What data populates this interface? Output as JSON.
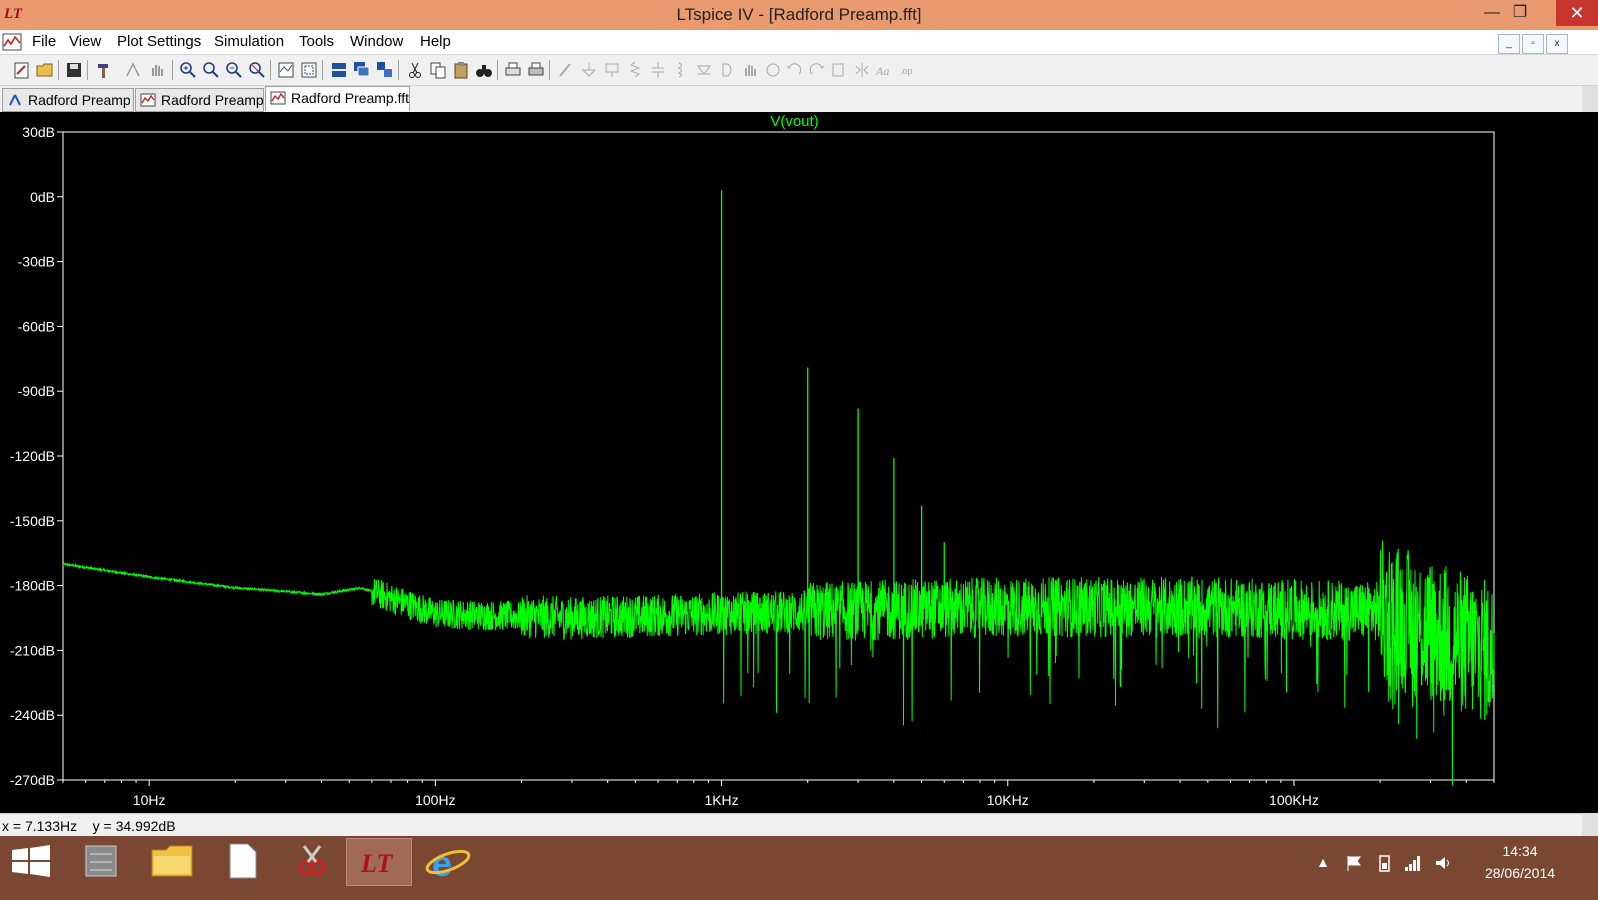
{
  "window": {
    "title": "LTspice IV - [Radford Preamp.fft]",
    "logo_text": "LT",
    "minimize": "—",
    "maximize": "❐",
    "close": "✕"
  },
  "menu": {
    "items": [
      "File",
      "View",
      "Plot Settings",
      "Simulation",
      "Tools",
      "Window",
      "Help"
    ],
    "mdi_buttons": [
      "_",
      "▫",
      "x"
    ]
  },
  "tabs": [
    {
      "label": "Radford Preamp",
      "icon": "schematic-icon"
    },
    {
      "label": "Radford Preamp",
      "icon": "waveform-icon"
    },
    {
      "label": "Radford Preamp.fft",
      "icon": "waveform-icon"
    }
  ],
  "status": {
    "text": "x = 7.133Hz    y = 34.992dB"
  },
  "taskbar": {
    "time": "14:34",
    "date": "28/06/2014"
  },
  "colors": {
    "trace": "#00ff00",
    "plot_bg": "#000000",
    "axis": "#ffffff"
  },
  "chart_data": {
    "type": "line",
    "title": "V(vout)",
    "x_scale": "log",
    "xlim": [
      5,
      500000
    ],
    "ylim": [
      -270,
      30
    ],
    "y_unit": "dB",
    "y_ticks": [
      "30dB",
      "0dB",
      "-30dB",
      "-60dB",
      "-90dB",
      "-120dB",
      "-150dB",
      "-180dB",
      "-210dB",
      "-240dB",
      "-270dB"
    ],
    "x_ticks": [
      "10Hz",
      "100Hz",
      "1KHz",
      "10KHz",
      "100KHz"
    ],
    "grid": false,
    "series": [
      {
        "noise_floor": [
          [
            5,
            -170
          ],
          [
            10,
            -176
          ],
          [
            20,
            -181
          ],
          [
            40,
            -184
          ],
          [
            55,
            -181
          ],
          [
            100,
            -193
          ],
          [
            300,
            -195
          ],
          [
            1000,
            -193
          ],
          [
            10000,
            -190
          ],
          [
            50000,
            -190
          ],
          [
            200000,
            -192
          ],
          [
            500000,
            -212
          ]
        ],
        "harmonics": [
          [
            1000,
            3
          ],
          [
            2000,
            -79
          ],
          [
            3000,
            -98
          ],
          [
            4000,
            -121
          ],
          [
            5000,
            -143
          ],
          [
            6000,
            -160
          ]
        ]
      }
    ]
  }
}
